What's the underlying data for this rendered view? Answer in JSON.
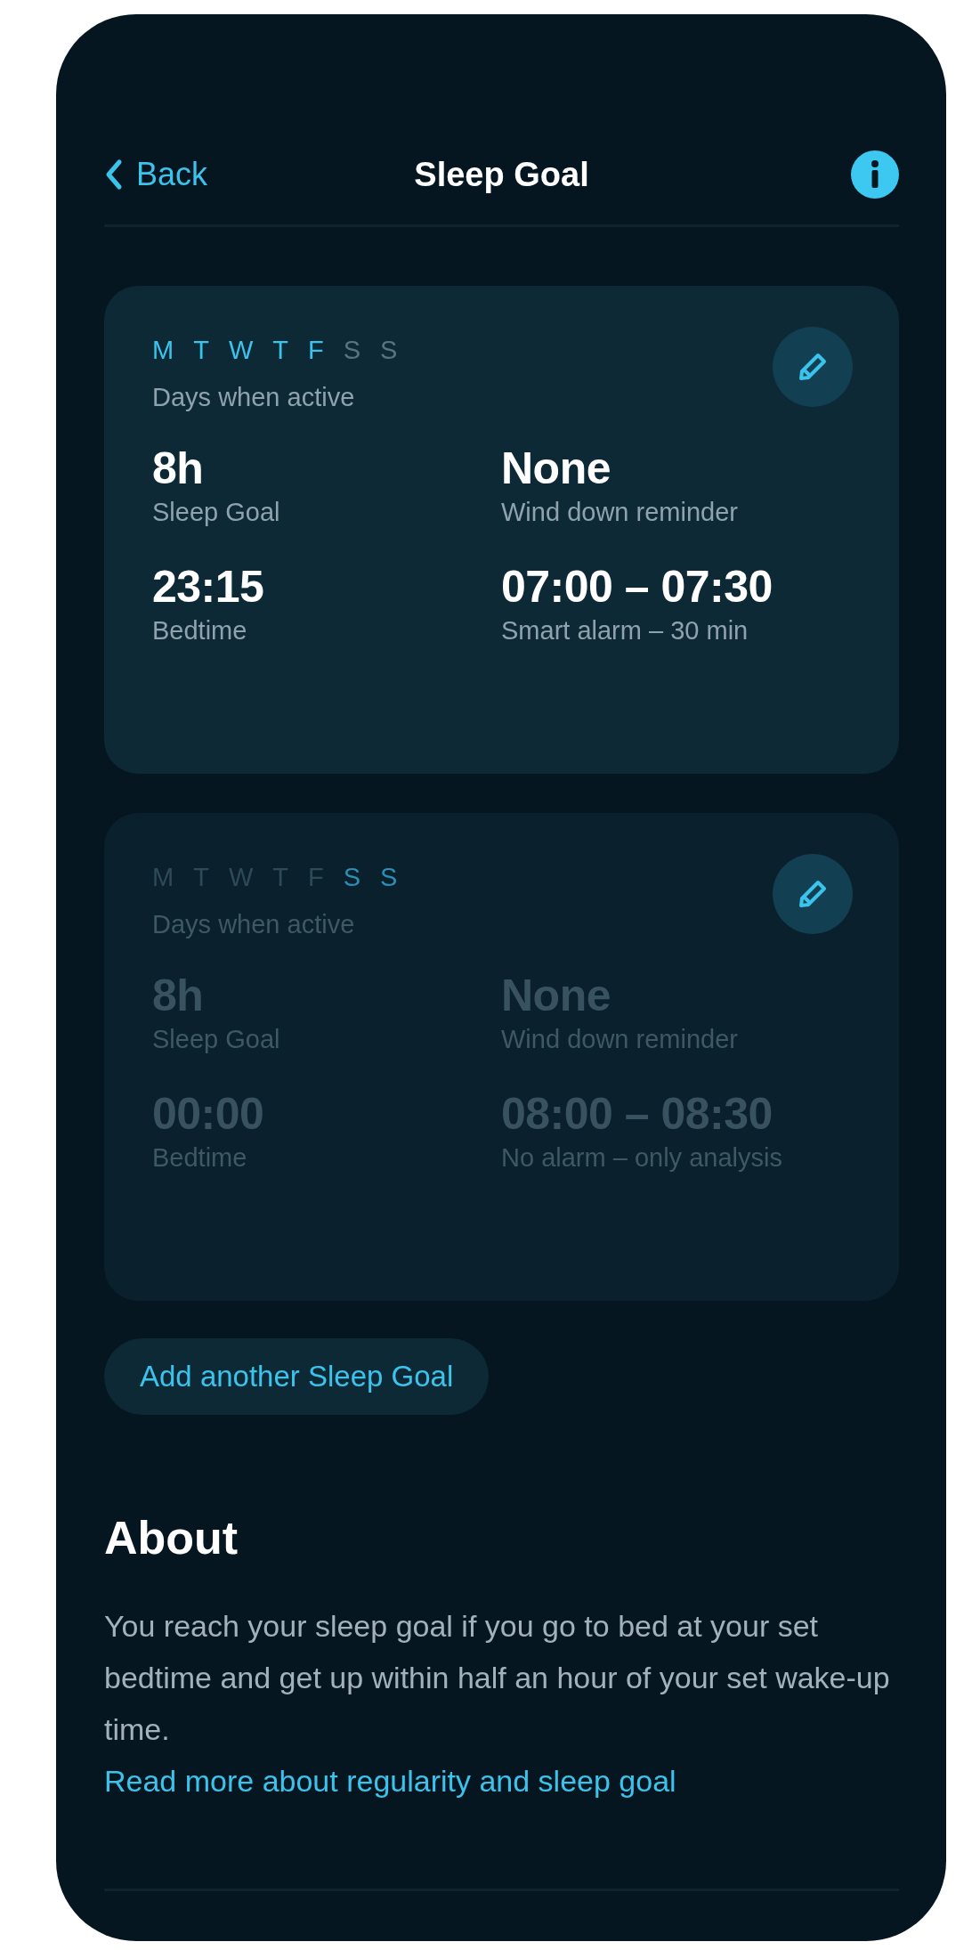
{
  "header": {
    "back": "Back",
    "title": "Sleep Goal"
  },
  "goals": [
    {
      "active": true,
      "days": [
        {
          "label": "M",
          "selected": true
        },
        {
          "label": "T",
          "selected": true
        },
        {
          "label": "W",
          "selected": true
        },
        {
          "label": "T",
          "selected": true
        },
        {
          "label": "F",
          "selected": true
        },
        {
          "label": "S",
          "selected": false
        },
        {
          "label": "S",
          "selected": false
        }
      ],
      "days_caption": "Days when active",
      "stats": [
        {
          "value": "8h",
          "label": "Sleep Goal"
        },
        {
          "value": "None",
          "label": "Wind down reminder"
        },
        {
          "value": "23:15",
          "label": "Bedtime"
        },
        {
          "value": "07:00 – 07:30",
          "label": "Smart alarm – 30 min"
        }
      ]
    },
    {
      "active": false,
      "days": [
        {
          "label": "M",
          "selected": false
        },
        {
          "label": "T",
          "selected": false
        },
        {
          "label": "W",
          "selected": false
        },
        {
          "label": "T",
          "selected": false
        },
        {
          "label": "F",
          "selected": false
        },
        {
          "label": "S",
          "selected": true
        },
        {
          "label": "S",
          "selected": true
        }
      ],
      "days_caption": "Days when active",
      "stats": [
        {
          "value": "8h",
          "label": "Sleep Goal"
        },
        {
          "value": "None",
          "label": "Wind down reminder"
        },
        {
          "value": "00:00",
          "label": "Bedtime"
        },
        {
          "value": "08:00 – 08:30",
          "label": "No alarm – only analysis"
        }
      ]
    }
  ],
  "add_button": "Add another Sleep Goal",
  "about": {
    "title": "About",
    "text": "You reach your sleep goal if you go to bed at your set bedtime and get up within half an hour of your set wake-up time.",
    "link": "Read more about regularity and sleep goal"
  }
}
